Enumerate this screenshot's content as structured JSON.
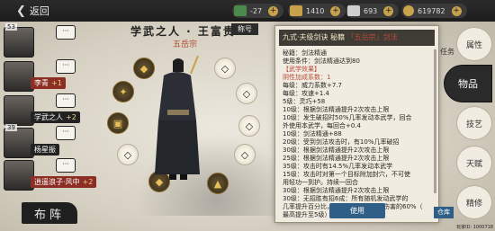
{
  "topbar": {
    "back_label": "返回",
    "resources": [
      {
        "icon": "leaf-icon",
        "value": "-27",
        "color": "#4a8a4a"
      },
      {
        "icon": "gold-ingot-icon",
        "value": "1410",
        "color": "#c8a24a"
      },
      {
        "icon": "sycee-icon",
        "value": "693",
        "color": "#cfcfcf"
      },
      {
        "icon": "coin-icon",
        "value": "619782",
        "color": "#caa24a"
      }
    ]
  },
  "team": {
    "members": [
      {
        "level": "53",
        "name": "",
        "plus": ""
      },
      {
        "level": "",
        "name": "李青",
        "plus": "+1"
      },
      {
        "level": "",
        "name": "学武之人",
        "plus": "+2"
      },
      {
        "level": "39",
        "name": "杨星振",
        "plus": ""
      },
      {
        "level": "",
        "name": "逍遥浪子·风中",
        "plus": "+2"
      }
    ],
    "formation_label": "布阵"
  },
  "character": {
    "title": "学武之人 · 王富贵",
    "rank_label": "称号",
    "sect": "五岳宗"
  },
  "popup": {
    "header_left": "九式·夫级剑诀",
    "header_mid": "秘籍",
    "header_tag": "「五岳宗」剑法",
    "lines": [
      "秘籍：剑法精通",
      "使用条件：剑法精通达到80",
      "【武学效果】",
      "阴性加成系数：1",
      "每级：威力系数+7.7",
      "每级：攻速+1.4",
      "5级：灵巧+58",
      "10级：根据剑法精通提升2次攻击上限",
      "10级：发生破招时50%几率发动本武学，回合",
      "外使用本武学，每回合+0.4",
      "10级：剑法精通+88",
      "20级：受到剑法攻击时，有10%几率破招",
      "30级：根据剑法精通提升2次攻击上限",
      "25级：根据剑法精通提升2次攻击上限",
      "35级：攻击时有14.5%几率发动本武学",
      "15级：攻击时对第一个目标附加封穴，不可使",
      "用轻功一到护。持续一回合",
      "30级：根据剑法精通提升2次攻击上限",
      "30级：无招胜有招6成：所有随机发动武学的",
      "几率提升百分比，在级数等为上一次伤害的60%（",
      "最高提升至5级）"
    ],
    "use_label": "使用"
  },
  "right_tabs": [
    "属性",
    "物品",
    "技艺",
    "天赋",
    "精修"
  ],
  "mission_label": "任务",
  "stash_label": "仓库",
  "uid": "玩家ID: 1000718"
}
